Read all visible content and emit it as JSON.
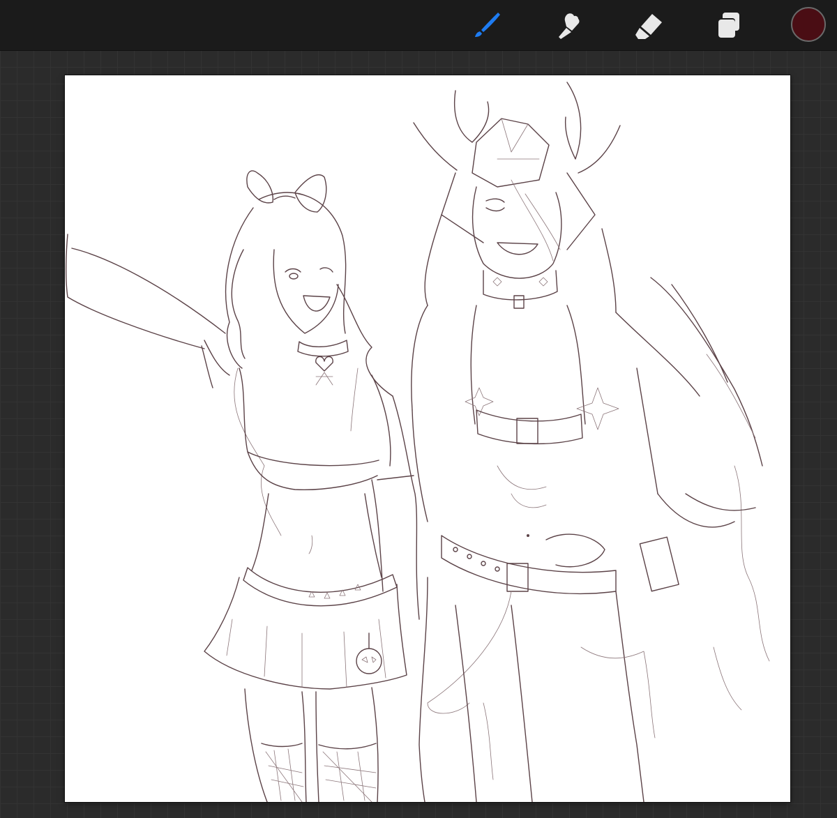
{
  "toolbar": {
    "tools": [
      {
        "name": "brush-tool",
        "icon": "brush-icon",
        "active": true
      },
      {
        "name": "smudge-tool",
        "icon": "smudge-icon",
        "active": false
      },
      {
        "name": "eraser-tool",
        "icon": "eraser-icon",
        "active": false
      },
      {
        "name": "layers-tool",
        "icon": "layers-icon",
        "active": false
      }
    ],
    "active_color": "#4a0d14",
    "active_tool_color": "#1e7cf2",
    "inactive_tool_color": "#e8e8e8"
  },
  "canvas": {
    "background": "#ffffff",
    "content": "line-art-sketch"
  }
}
